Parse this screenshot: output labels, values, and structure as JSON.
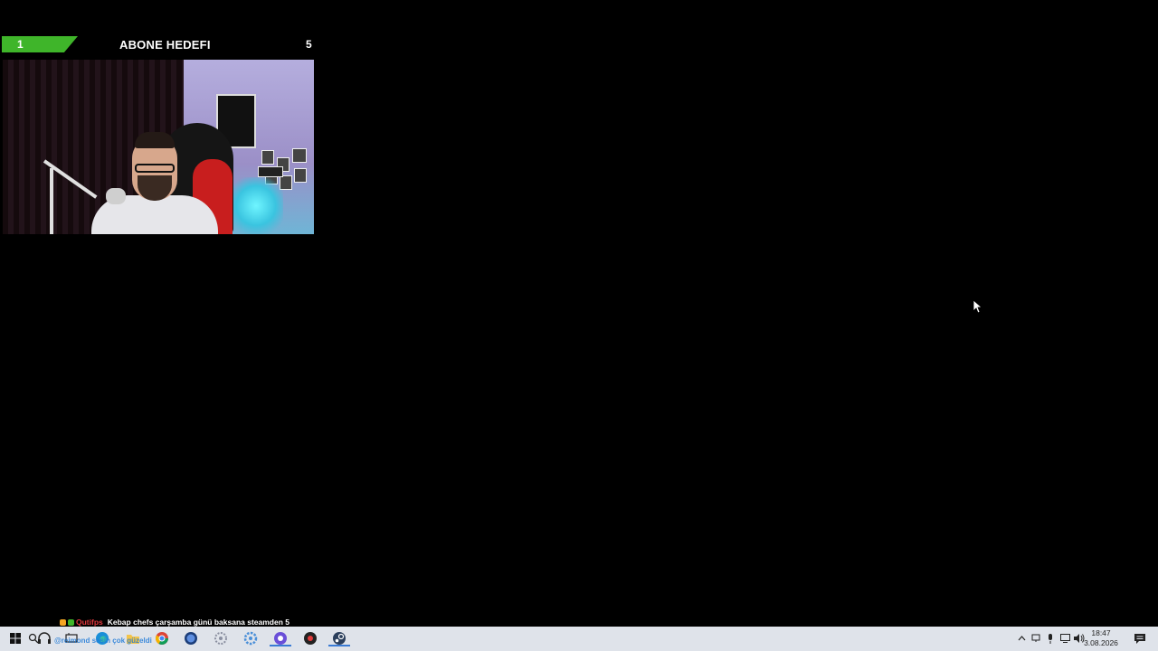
{
  "goal": {
    "current": "1",
    "title": "ABONE HEDEFI",
    "target": "5",
    "progress_fraction": 0.2,
    "fill_color": "#3fb52a"
  },
  "webcam": {
    "description_icon": "webcam-feed"
  },
  "chat": {
    "username": "Qutifps",
    "message": "Kebap chefs çarşamba günü baksana steamden 5",
    "username_color": "#e0383e"
  },
  "taskbar": {
    "overlay_text": "@reimond sesin çok güzeldi",
    "apps": [
      "windows-start-icon",
      "search-icon",
      "headset-icon",
      "task-view-icon",
      "edge-icon",
      "folder-icon",
      "chrome-icon",
      "circle-app-icon",
      "settings-app-icon",
      "gear-app-icon",
      "obs-icon",
      "record-app-icon",
      "steam-icon"
    ],
    "tray_icons": [
      "chevron-up-icon",
      "network-icon",
      "microphone-icon",
      "display-icon",
      "volume-icon"
    ],
    "time": "18:47",
    "date": "3.08.2026"
  }
}
